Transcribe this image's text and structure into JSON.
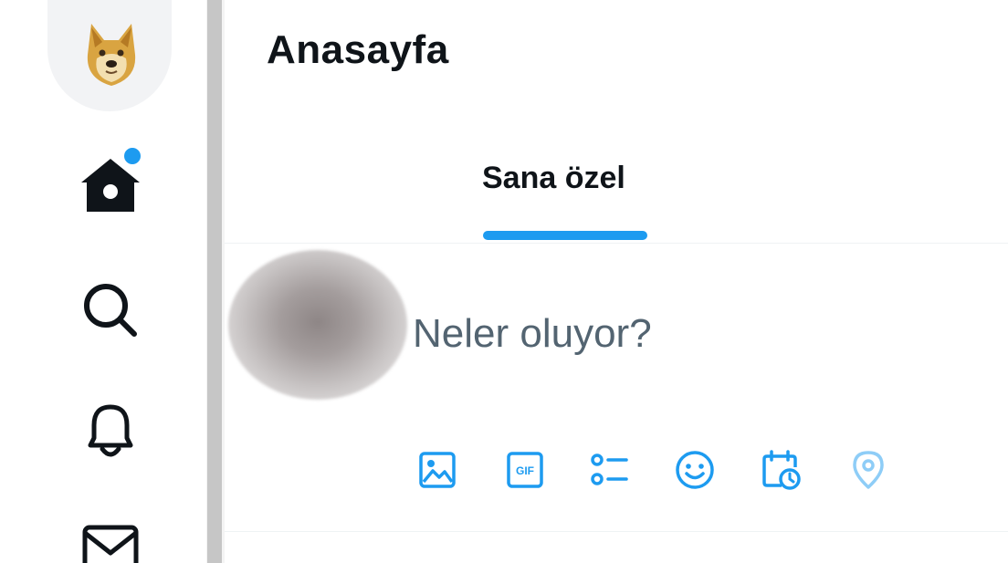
{
  "header": {
    "title": "Anasayfa"
  },
  "tabs": [
    {
      "label": "Sana özel",
      "active": true
    }
  ],
  "composer": {
    "placeholder": "Neler oluyor?",
    "toolbar": [
      {
        "icon": "image-icon"
      },
      {
        "icon": "gif-icon",
        "text": "GIF"
      },
      {
        "icon": "poll-icon"
      },
      {
        "icon": "emoji-icon"
      },
      {
        "icon": "schedule-icon"
      },
      {
        "icon": "location-icon"
      }
    ]
  },
  "sidebar": {
    "items": [
      {
        "icon": "home-icon",
        "has_notification": true
      },
      {
        "icon": "search-icon"
      },
      {
        "icon": "bell-icon"
      },
      {
        "icon": "mail-icon"
      }
    ]
  },
  "colors": {
    "accent": "#1d9bf0",
    "text_primary": "#0f1419",
    "text_secondary": "#536471",
    "divider": "#eff3f4"
  }
}
